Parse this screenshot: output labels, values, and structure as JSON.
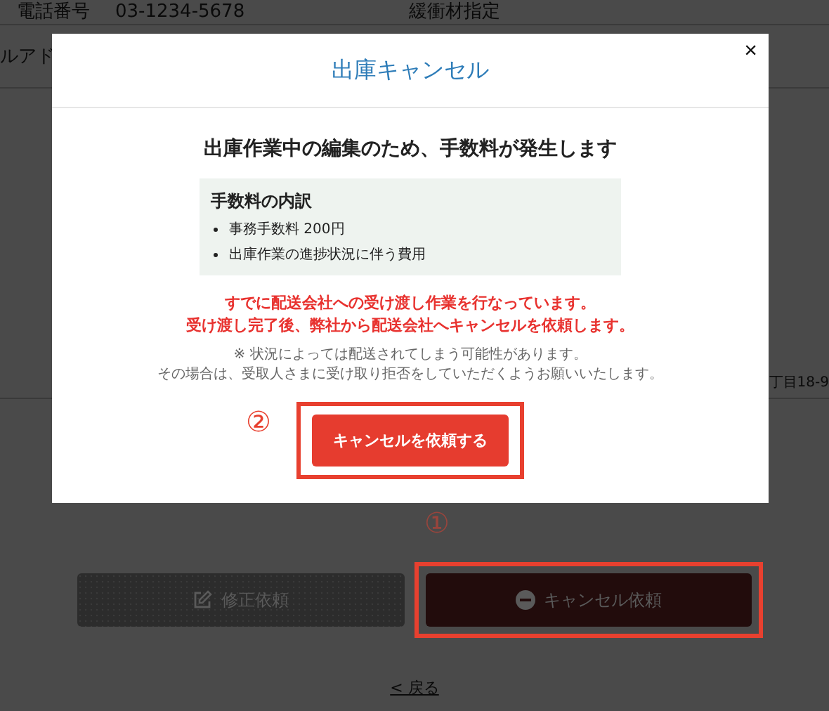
{
  "page": {
    "phone_label": "電話番号",
    "phone_value": "03-1234-5678",
    "packing_label": "緩衝材指定",
    "email_label": "ルアド",
    "address": "丁目18-9",
    "buttons": [
      {
        "label": "修正依頼",
        "kind": "edit",
        "disabled": true,
        "highlighted": false
      },
      {
        "label": "キャンセル依頼",
        "kind": "cancel",
        "disabled": false,
        "highlighted": true
      }
    ],
    "back_link": "< 戻る",
    "marker": "①"
  },
  "modal": {
    "title": "出庫キャンセル",
    "close": "×",
    "heading": "出庫作業中の編集のため、手数料が発生します",
    "fee_breakdown": {
      "title": "手数料の内訳",
      "items": [
        "事務手数料 200円",
        "出庫作業の進捗状況に伴う費用"
      ]
    },
    "warnings": [
      "すでに配送会社への受け渡し作業を行なっています。",
      "受け渡し完了後、弊社から配送会社へキャンセルを依頼します。"
    ],
    "notes": [
      "※ 状況によっては配送されてしまう可能性があります。",
      "その場合は、受取人さまに受け取り拒否をしていただくようお願いいたします。"
    ],
    "confirm_button": {
      "label": "キャンセルを依頼する",
      "highlighted": true
    },
    "marker": "②"
  }
}
